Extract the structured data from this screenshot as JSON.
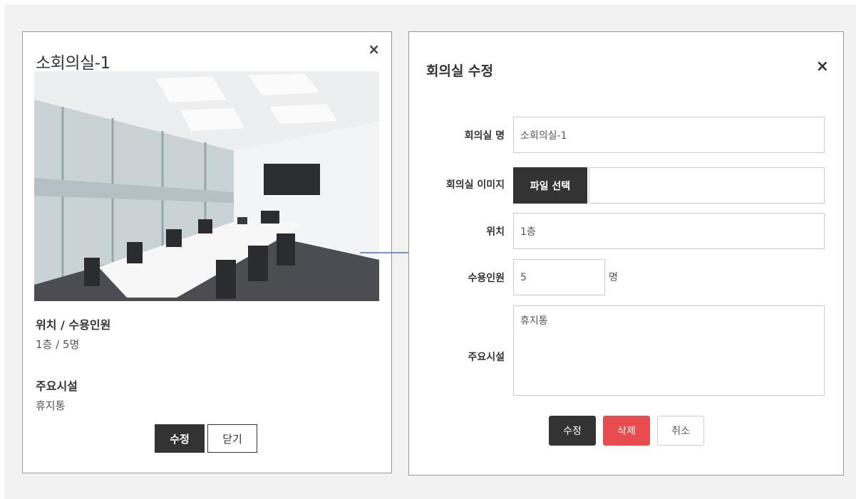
{
  "detail_card": {
    "title": "소회의실-1",
    "close_icon": "×",
    "photo_alt": "meeting-room-photo",
    "location_capacity_label": "위치 / 수용인원",
    "location_capacity_value": "1층 / 5명",
    "facilities_label": "주요시설",
    "facilities_value": "휴지통",
    "edit_button": "수정",
    "close_button": "닫기"
  },
  "edit_modal": {
    "title": "회의실 수정",
    "close_icon": "×",
    "name_label": "회의실 명",
    "name_value": "소회의실-1",
    "image_label": "회의실 이미지",
    "file_button": "파일 선택",
    "file_value": "",
    "location_label": "위치",
    "location_value": "1층",
    "capacity_label": "수용인원",
    "capacity_value": "5",
    "capacity_unit": "명",
    "facilities_label": "주요시설",
    "facilities_value": "휴지통",
    "save_button": "수정",
    "delete_button": "삭제",
    "cancel_button": "취소"
  },
  "colors": {
    "dark_button": "#333333",
    "delete_button": "#e84c4f",
    "arrow": "#4472c4"
  }
}
